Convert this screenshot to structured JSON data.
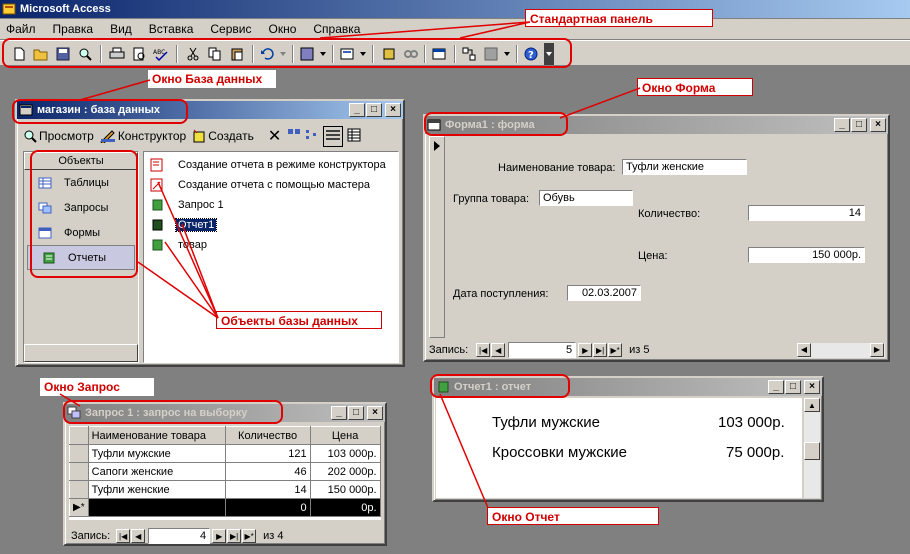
{
  "app": {
    "title": "Microsoft Access"
  },
  "menu": [
    "Файл",
    "Правка",
    "Вид",
    "Вставка",
    "Сервис",
    "Окно",
    "Справка"
  ],
  "annotations": {
    "standard_panel": "Стандартная панель",
    "db_window": "Окно База данных",
    "form_window": "Окно Форма",
    "db_objects": "Объекты базы данных",
    "query_window": "Окно Запрос",
    "report_window": "Окно Отчет"
  },
  "db_window": {
    "title": "магазин : база данных",
    "toolbar": {
      "view": "Просмотр",
      "design": "Конструктор",
      "create": "Создать"
    },
    "objects_header": "Объекты",
    "objects": [
      "Таблицы",
      "Запросы",
      "Формы",
      "Отчеты"
    ],
    "items": [
      "Создание отчета в режиме конструктора",
      "Создание отчета с помощью мастера",
      "Запрос 1",
      "Отчет1",
      "товар"
    ]
  },
  "form_window": {
    "title": "Форма1 : форма",
    "name_label": "Наименование товара:",
    "name_value": "Туфли женские",
    "group_label": "Группа товара:",
    "group_value": "Обувь",
    "qty_label": "Количество:",
    "qty_value": "14",
    "price_label": "Цена:",
    "price_value": "150 000р.",
    "date_label": "Дата поступления:",
    "date_value": "02.03.2007",
    "nav_label": "Запись:",
    "nav_current": "5",
    "nav_of": "из  5"
  },
  "query_window": {
    "title": "Запрос 1 : запрос на выборку",
    "columns": [
      "Наименование товара",
      "Количество",
      "Цена"
    ],
    "rows": [
      [
        "Туфли мужские",
        "121",
        "103 000р."
      ],
      [
        "Сапоги женские",
        "46",
        "202 000р."
      ],
      [
        "Туфли женские",
        "14",
        "150 000р."
      ],
      [
        "",
        "0",
        "0р."
      ]
    ],
    "nav_label": "Запись:",
    "nav_current": "4",
    "nav_of": "из  4"
  },
  "report_window": {
    "title": "Отчет1 : отчет",
    "lines": [
      {
        "name": "Туфли мужские",
        "price": "103 000р."
      },
      {
        "name": "Кроссовки мужские",
        "price": "75 000р."
      }
    ]
  },
  "colors": {
    "accent_red": "#d00000",
    "title_active": "#0a246a",
    "face": "#d4d0c8"
  }
}
